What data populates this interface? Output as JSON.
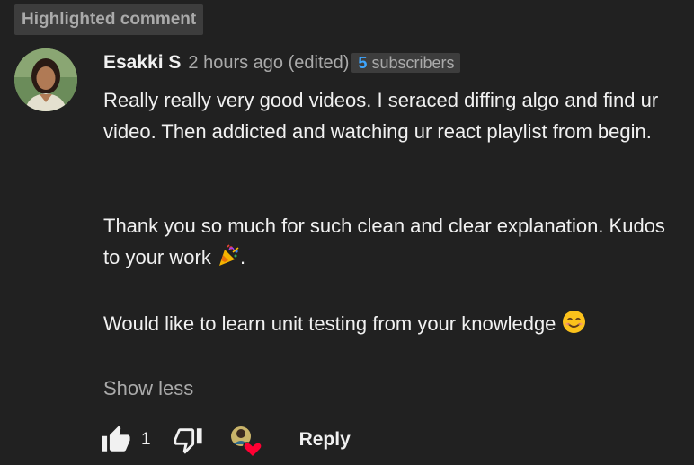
{
  "highlight_label": "Highlighted comment",
  "comment": {
    "author": "Esakki S",
    "timestamp": "2 hours ago (edited)",
    "subscriber_count": "5",
    "subscriber_label": "subscribers",
    "body_paragraph_1": "Really really very good videos. I seraced diffing algo and find ur video. Then addicted and watching ur react playlist from begin.",
    "body_paragraph_2": "Thank you so much for such clean and clear explanation. Kudos to your work ",
    "body_paragraph_2_emoji": "🎉",
    "body_paragraph_2_tail": ".",
    "body_paragraph_3": "Would like to learn unit testing from your knowledge ",
    "body_paragraph_3_emoji": "😊",
    "show_less_label": "Show less"
  },
  "actions": {
    "like_count": "1",
    "reply_label": "Reply",
    "icons": {
      "like": "thumbs-up-filled-icon",
      "dislike": "thumbs-down-outline-icon",
      "creator_heart": "creator-heart-icon"
    }
  },
  "colors": {
    "background": "#212121",
    "primary_text": "#f1f1f1",
    "secondary_text": "#aaaaaa",
    "chip_background": "#3d3d3d",
    "subscriber_count": "#3ea6ff",
    "heart": "#ff0033"
  }
}
